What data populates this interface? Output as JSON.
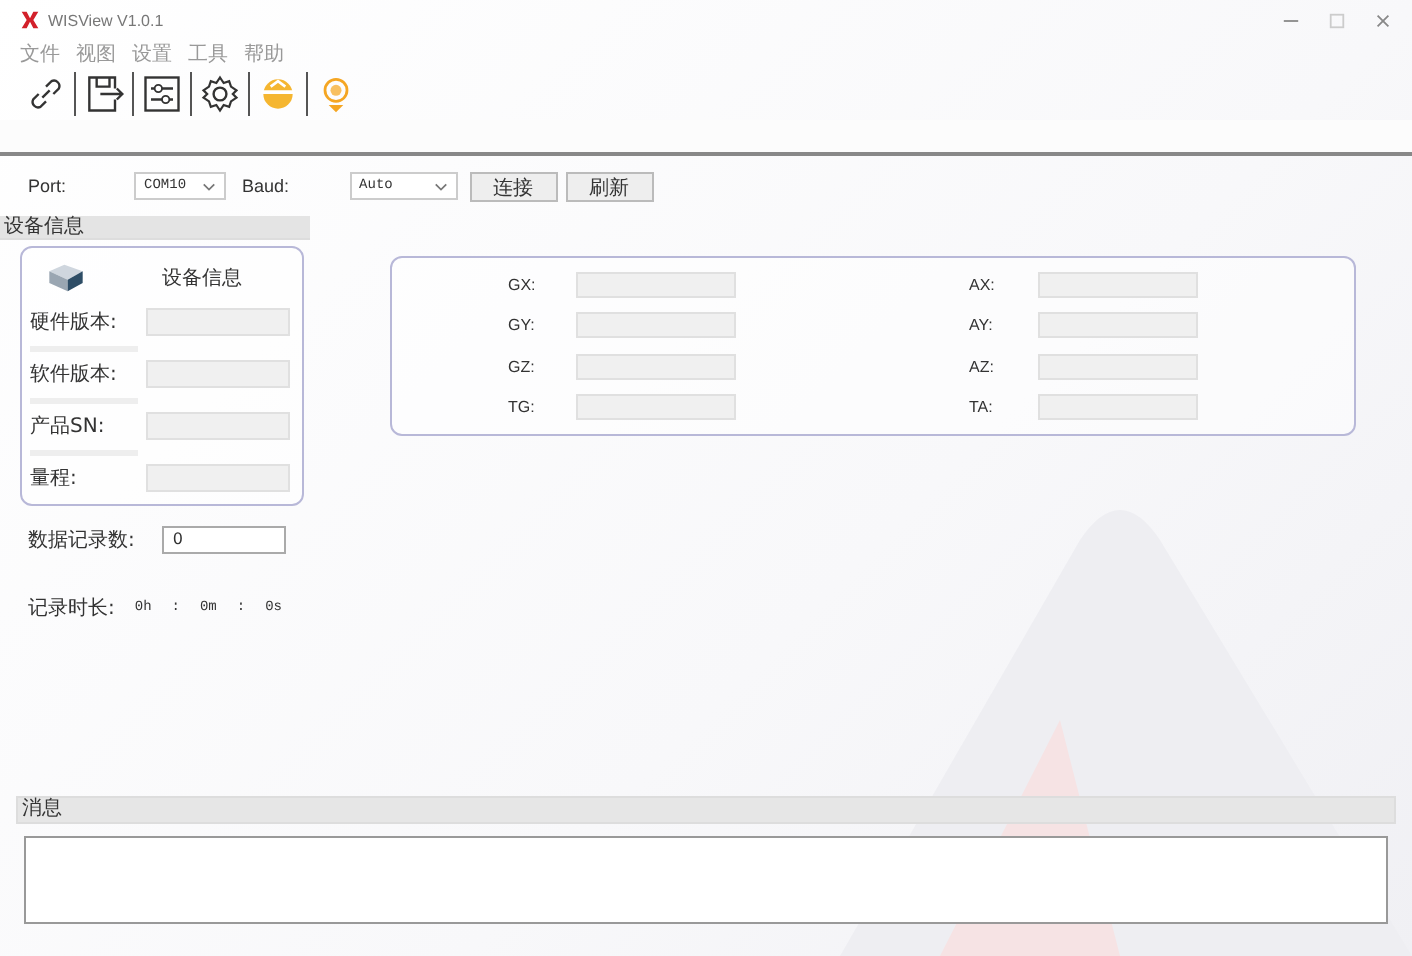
{
  "window": {
    "title": "WISView V1.0.1"
  },
  "menu": [
    "文件",
    "视图",
    "设置",
    "工具",
    "帮助"
  ],
  "connection": {
    "port_label": "Port:",
    "port": "COM10",
    "baud_label": "Baud:",
    "baud": "Auto",
    "buttons": [
      "连接",
      "刷新"
    ]
  },
  "device_panel": {
    "header": "设备信息",
    "title": "设备信息",
    "fields": [
      {
        "label": "硬件版本:"
      },
      {
        "label": "软件版本:"
      },
      {
        "label": "产品SN:"
      },
      {
        "label": "量程:"
      }
    ]
  },
  "sensor_fields": [
    {
      "label": "GX:"
    },
    {
      "label": "AX:"
    },
    {
      "label": "GY:"
    },
    {
      "label": "AY:"
    },
    {
      "label": "GZ:"
    },
    {
      "label": "AZ:"
    },
    {
      "label": "TG:"
    },
    {
      "label": "TA:"
    }
  ],
  "record_count": {
    "label": "数据记录数:",
    "value": "0"
  },
  "record_duration": {
    "label": "记录时长:",
    "parts": [
      "0h",
      ":",
      "0m",
      ":",
      "0s"
    ]
  },
  "messages": {
    "header": "消息"
  }
}
